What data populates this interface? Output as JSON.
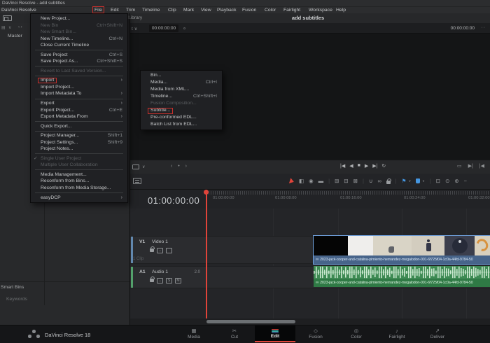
{
  "window": {
    "title": "DaVinci Resolve - add subtitles"
  },
  "menu_bar": {
    "items": [
      "DaVinci Resolve",
      "File",
      "Edit",
      "Trim",
      "Timeline",
      "Clip",
      "Mark",
      "View",
      "Playback",
      "Fusion",
      "Color",
      "Fairlight",
      "Workspace",
      "Help"
    ],
    "highlighted": "File"
  },
  "file_menu": {
    "items": [
      {
        "label": "New Project..."
      },
      {
        "label": "New Bin",
        "shortcut": "Ctrl+Shift+N",
        "disabled": true
      },
      {
        "label": "New Smart Bin...",
        "disabled": true
      },
      {
        "label": "New Timeline...",
        "shortcut": "Ctrl+N"
      },
      {
        "label": "Close Current Timeline"
      },
      {
        "separator": true
      },
      {
        "label": "Save Project",
        "shortcut": "Ctrl+S"
      },
      {
        "label": "Save Project As...",
        "shortcut": "Ctrl+Shift+S"
      },
      {
        "separator": true
      },
      {
        "label": "Revert to Last Saved Version...",
        "disabled": true
      },
      {
        "separator": true
      },
      {
        "label": "Import",
        "submenu": true,
        "highlighted": true
      },
      {
        "label": "Import Project..."
      },
      {
        "label": "Import Metadata To",
        "submenu": true
      },
      {
        "separator": true
      },
      {
        "label": "Export",
        "submenu": true
      },
      {
        "label": "Export Project...",
        "shortcut": "Ctrl+E"
      },
      {
        "label": "Export Metadata From",
        "submenu": true
      },
      {
        "separator": true
      },
      {
        "label": "Quick Export..."
      },
      {
        "separator": true
      },
      {
        "label": "Project Manager...",
        "shortcut": "Shift+1"
      },
      {
        "label": "Project Settings...",
        "shortcut": "Shift+9"
      },
      {
        "label": "Project Notes..."
      },
      {
        "separator": true
      },
      {
        "label": "Single User Project",
        "disabled": true,
        "checked": true
      },
      {
        "label": "Multiple User Collaboration",
        "disabled": true
      },
      {
        "separator": true
      },
      {
        "label": "Media Management..."
      },
      {
        "label": "Reconform from Bins..."
      },
      {
        "label": "Reconform from Media Storage..."
      },
      {
        "separator": true
      },
      {
        "label": "easyDCP",
        "submenu": true
      }
    ]
  },
  "import_submenu": {
    "items": [
      {
        "label": "Bin..."
      },
      {
        "label": "Media...",
        "shortcut": "Ctrl+I"
      },
      {
        "label": "Media from XML..."
      },
      {
        "label": "Timeline...",
        "shortcut": "Ctrl+Shift+I"
      },
      {
        "label": "Fusion Composition...",
        "disabled": true
      },
      {
        "label": "Subtitle...",
        "highlighted": true
      },
      {
        "label": "Pre-conformed EDL..."
      },
      {
        "label": "Batch List from EDL..."
      }
    ]
  },
  "top_bar": {
    "library_label": "l Library",
    "timeline_title": "add subtitles"
  },
  "viewer": {
    "zoom_fragment": "t",
    "left_timecode": "00:00:00:00",
    "right_timecode": "00:00:00:00",
    "more_label": "··"
  },
  "media_pool": {
    "master_label": "Master",
    "smart_bins_label": "Smart Bins",
    "keywords_label": "Keywords"
  },
  "timeline": {
    "current_timecode": "01:00:00:00",
    "ruler_labels": [
      "01:00:00:00",
      "01:00:08:00",
      "01:00:16:00",
      "01:00:24:00",
      "01:00:32:00"
    ],
    "video_track": {
      "id": "V1",
      "name": "Video 1",
      "clip_count": "1 Clip"
    },
    "audio_track": {
      "id": "A1",
      "name": "Audio 1",
      "channels": "2.0",
      "solo": "S",
      "mute": "M"
    },
    "clip_name": "2023-jack-cooper-and-catalina-pimiento-hernandez-megalodon-001-6f725f04-1c0a-44fd-9784-50"
  },
  "status_bar": {
    "version_label": "DaVinci Resolve 18",
    "tabs": [
      "Media",
      "Cut",
      "Edit",
      "Fusion",
      "Color",
      "Fairlight",
      "Deliver"
    ],
    "active_tab": "Edit"
  },
  "icons": {
    "prev_clip": "|◀",
    "step_back": "◀",
    "stop": "■",
    "play": "▶",
    "next_clip": "▶|",
    "loop": "↻",
    "loop_box": "▭",
    "goto_end": "▶|",
    "goto_start": "|◀",
    "jog": "‹ • ›",
    "trim_mode": "◧",
    "dynamic_trim": "◉",
    "razor": "▬",
    "insert_clip": "⊞",
    "overwrite_clip": "⊟",
    "replace_clip": "⊠",
    "snap": "∪",
    "link": "∞",
    "flag": "⚑",
    "chevron": "∨",
    "zoom_full": "⊡",
    "zoom_detail": "⊙",
    "zoom_custom": "⊕",
    "zoom_minus": "−",
    "track_autoselect": "↔",
    "tab_media": "▦",
    "tab_cut": "✂",
    "tab_fusion": "◇",
    "tab_color": "◎",
    "tab_fairlight": "♪",
    "tab_deliver": "↗",
    "mp_view": "▤",
    "mp_chevron": "∨"
  },
  "colors": {
    "accent_red": "#e0443a",
    "highlight_box": "#c9302c",
    "video_name_bar": "#47648a",
    "audio_clip": "#3e8b54",
    "audio_name_bar": "#2f7a45",
    "video_track_bar": "#6288ae",
    "audio_track_bar": "#53a06b",
    "flag_blue": "#4596e0",
    "edit_icon_bars": [
      "#e0443a",
      "#3fb5b0",
      "#5a8fd6"
    ]
  }
}
